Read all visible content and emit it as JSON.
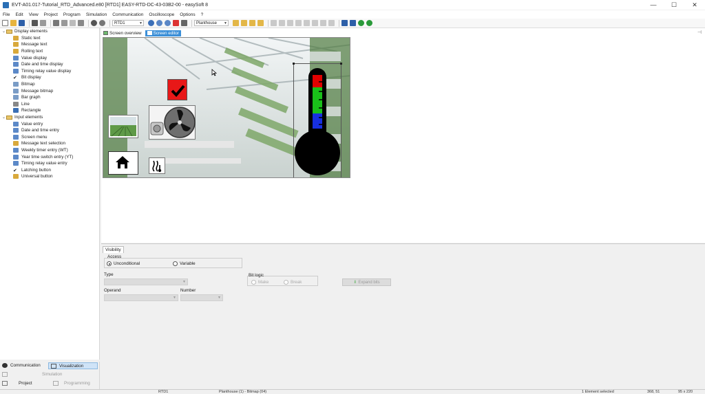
{
  "window": {
    "title": "EVT-A01.017-Tutorial_RTD_Advanced.e80 [RTD1] EASY-RTD-DC-43-03B2-00 - easySoft 8",
    "minimize": "—",
    "maximize": "☐",
    "close": "✕"
  },
  "menu": [
    "File",
    "Edit",
    "View",
    "Project",
    "Program",
    "Simulation",
    "Communication",
    "Oscilloscope",
    "Options",
    "?"
  ],
  "toolbar": {
    "device_combo": "RTD1",
    "screen_combo": "Planthouse"
  },
  "tree": {
    "display_group": "Display elements",
    "display_items": [
      {
        "label": "Static text",
        "icon": "static-text-icon",
        "color": "#d9a93c"
      },
      {
        "label": "Message text",
        "icon": "message-text-icon",
        "color": "#d9a93c"
      },
      {
        "label": "Rolling text",
        "icon": "rolling-text-icon",
        "color": "#d9a93c"
      },
      {
        "label": "Value display",
        "icon": "value-display-icon",
        "color": "#5c89c8"
      },
      {
        "label": "Date and time display",
        "icon": "date-time-display-icon",
        "color": "#5c89c8"
      },
      {
        "label": "Timing relay value display",
        "icon": "timing-relay-display-icon",
        "color": "#5c89c8"
      },
      {
        "label": "Bit display",
        "icon": "checkmark-icon",
        "color": "#222222"
      },
      {
        "label": "Bitmap",
        "icon": "bitmap-icon",
        "color": "#7a9cc6"
      },
      {
        "label": "Message bitmap",
        "icon": "message-bitmap-icon",
        "color": "#7a9cc6"
      },
      {
        "label": "Bar graph",
        "icon": "bar-graph-icon",
        "color": "#7a9cc6"
      },
      {
        "label": "Line",
        "icon": "line-icon",
        "color": "#888888"
      },
      {
        "label": "Rectangle",
        "icon": "rectangle-icon",
        "color": "#3a6fb5"
      }
    ],
    "input_group": "Input elements",
    "input_items": [
      {
        "label": "Value entry",
        "icon": "value-entry-icon",
        "color": "#5c89c8"
      },
      {
        "label": "Date and time entry",
        "icon": "date-time-entry-icon",
        "color": "#5c89c8"
      },
      {
        "label": "Screen menu",
        "icon": "screen-menu-icon",
        "color": "#5c89c8"
      },
      {
        "label": "Message text selection",
        "icon": "message-text-selection-icon",
        "color": "#d9a93c"
      },
      {
        "label": "Weekly timer entry (WT)",
        "icon": "weekly-timer-icon",
        "color": "#5c89c8"
      },
      {
        "label": "Year time switch entry (YT)",
        "icon": "year-time-switch-icon",
        "color": "#5c89c8"
      },
      {
        "label": "Timing relay value entry",
        "icon": "timing-relay-entry-icon",
        "color": "#5c89c8"
      },
      {
        "label": "Latching button",
        "icon": "checkmark-icon",
        "color": "#222222"
      },
      {
        "label": "Universal button",
        "icon": "universal-button-icon",
        "color": "#d9a93c"
      }
    ]
  },
  "sidebar_bottom": {
    "communication": "Communication",
    "visualization": "Visualization",
    "simulation": "Simulation",
    "project": "Project",
    "programming": "Programming"
  },
  "view_tabs": {
    "overview": "Screen overview",
    "editor": "Screen editor"
  },
  "props": {
    "tab": "Visibility",
    "access_title": "Access",
    "unconditional": "Unconditional",
    "variable": "Variable",
    "type_label": "Type",
    "bit_logic_title": "Bit logic",
    "make": "Make",
    "break": "Break",
    "expand_bits": "Expand bits",
    "operand_label": "Operand",
    "number_label": "Number"
  },
  "status": {
    "device": "RTD1",
    "screen": "Planthouse (1) - Bitmap (04)",
    "selection": "1 Element selected",
    "position": "368, 51",
    "size": "95 x 220"
  },
  "colors": {
    "accent": "#3b8fd8",
    "thermo_red": "#e00000",
    "thermo_green": "#19c019",
    "thermo_blue": "#1730e0",
    "check_red": "#e81818"
  }
}
